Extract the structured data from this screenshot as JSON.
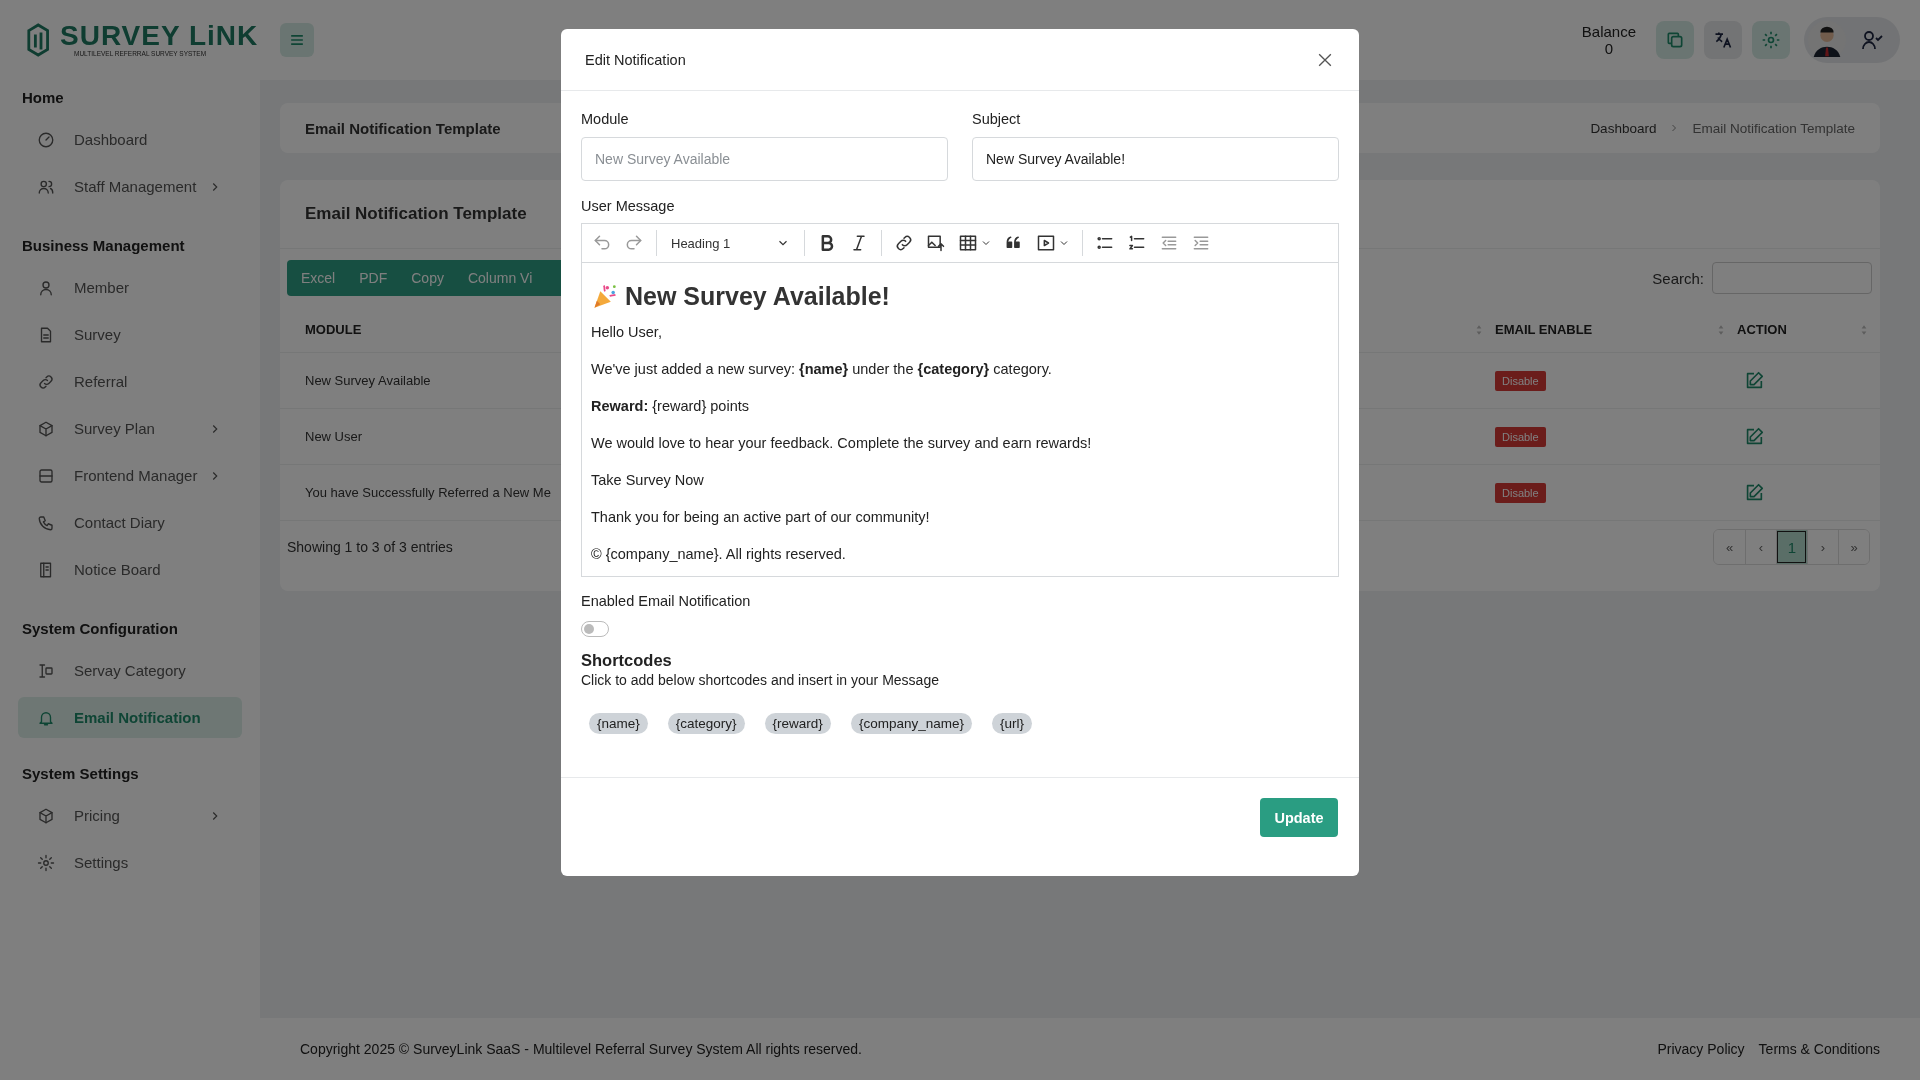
{
  "logo": {
    "title": "SURVEY LiNK",
    "tagline": "MULTILEVEL REFERRAL SURVEY SYSTEM"
  },
  "header": {
    "balance_label": "Balance",
    "balance_value": "0"
  },
  "sidebar": {
    "sections": [
      {
        "title": "Home",
        "items": [
          {
            "label": "Dashboard",
            "expandable": false,
            "selected": false
          },
          {
            "label": "Staff Management",
            "expandable": true,
            "selected": false
          }
        ]
      },
      {
        "title": "Business Management",
        "items": [
          {
            "label": "Member",
            "expandable": false,
            "selected": false
          },
          {
            "label": "Survey",
            "expandable": false,
            "selected": false
          },
          {
            "label": "Referral",
            "expandable": false,
            "selected": false
          },
          {
            "label": "Survey Plan",
            "expandable": true,
            "selected": false
          },
          {
            "label": "Frontend Manager",
            "expandable": true,
            "selected": false
          },
          {
            "label": "Contact Diary",
            "expandable": false,
            "selected": false
          },
          {
            "label": "Notice Board",
            "expandable": false,
            "selected": false
          }
        ]
      },
      {
        "title": "System Configuration",
        "items": [
          {
            "label": "Servay Category",
            "expandable": false,
            "selected": false
          },
          {
            "label": "Email Notification",
            "expandable": false,
            "selected": true
          }
        ]
      },
      {
        "title": "System Settings",
        "items": [
          {
            "label": "Pricing",
            "expandable": true,
            "selected": false
          },
          {
            "label": "Settings",
            "expandable": false,
            "selected": false
          }
        ]
      }
    ]
  },
  "breadcrumb": {
    "page_title": "Email Notification Template",
    "items": [
      "Dashboard",
      "Email Notification Template"
    ]
  },
  "table_card": {
    "title": "Email Notification Template",
    "export_buttons": [
      "Excel",
      "PDF",
      "Copy",
      "Column Vi"
    ],
    "search_label": "Search:",
    "columns": [
      "MODULE",
      "EMAIL ENABLE",
      "ACTION"
    ],
    "rows": [
      {
        "module": "New Survey Available",
        "email_enable": "Disable"
      },
      {
        "module": "New User",
        "email_enable": "Disable"
      },
      {
        "module": "You have Successfully Referred a New Me",
        "email_enable": "Disable"
      }
    ],
    "info": "Showing 1 to 3 of 3 entries",
    "pagination": [
      {
        "label": "«",
        "selected": false
      },
      {
        "label": "‹",
        "selected": false
      },
      {
        "label": "1",
        "selected": true
      },
      {
        "label": "›",
        "selected": false
      },
      {
        "label": "»",
        "selected": false
      }
    ]
  },
  "footer": {
    "copyright": "Copyright 2025 © SurveyLink SaaS - Multilevel Referral Survey System All rights reserved.",
    "links": [
      "Privacy Policy",
      "Terms & Conditions"
    ]
  },
  "modal": {
    "title": "Edit Notification",
    "module": {
      "label": "Module",
      "placeholder": "New Survey Available"
    },
    "subject": {
      "label": "Subject",
      "value": "New Survey Available!"
    },
    "editor": {
      "label": "User Message",
      "block_style": "Heading 1",
      "content": [
        {
          "kind": "heading",
          "text": "New Survey Available!"
        },
        {
          "kind": "paragraph",
          "text": "Hello User,"
        },
        {
          "kind": "paragraph",
          "text": "We've just added a new survey: **{name}** under the **{category}** category."
        },
        {
          "kind": "paragraph",
          "text": "**Reward:** {reward} points"
        },
        {
          "kind": "paragraph",
          "text": "We would love to hear your feedback. Complete the survey and earn rewards!"
        },
        {
          "kind": "paragraph",
          "text": "Take Survey Now"
        },
        {
          "kind": "paragraph",
          "text": "Thank you for being an active part of our community!"
        },
        {
          "kind": "paragraph",
          "text": "© {company_name}. All rights reserved."
        }
      ]
    },
    "notification": {
      "label": "Enabled Email Notification",
      "on": false
    },
    "shortcodes": {
      "title": "Shortcodes",
      "description": "Click to add below shortcodes and insert in your Message",
      "codes": [
        "{name}",
        "{category}",
        "{reward}",
        "{company_name}",
        "{url}"
      ]
    },
    "submit": "Update"
  }
}
